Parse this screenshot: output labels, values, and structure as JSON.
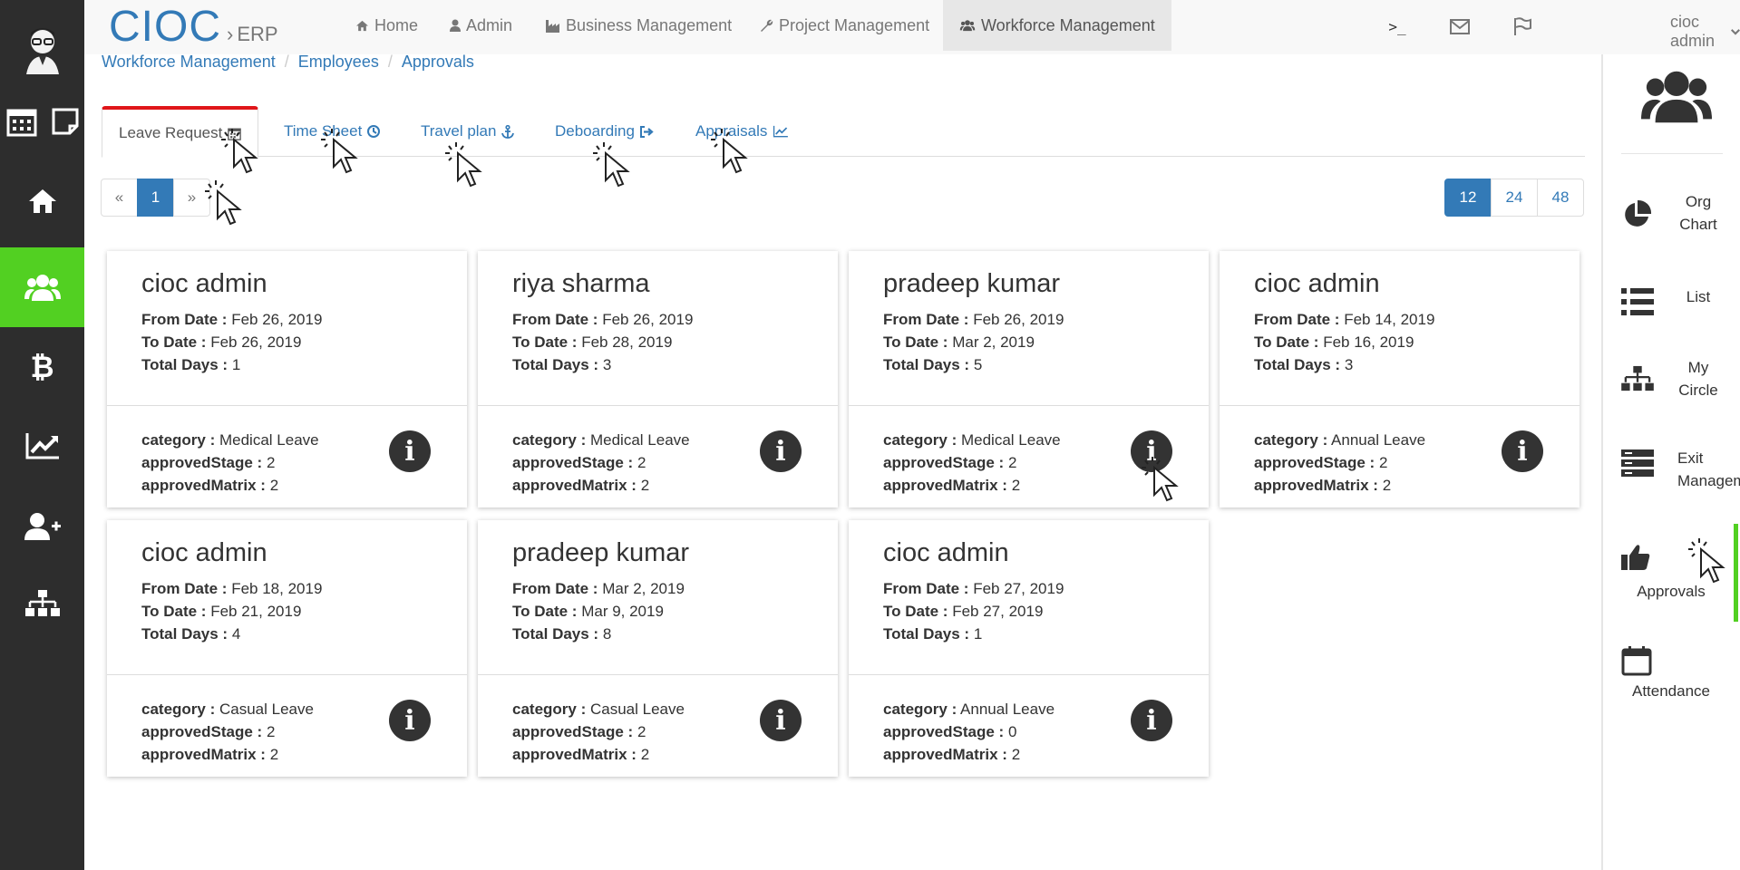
{
  "brand": {
    "main": "CIOC",
    "sep": "›",
    "sub": "ERP"
  },
  "nav": {
    "items": [
      {
        "label": "Home",
        "icon": "home-icon"
      },
      {
        "label": "Admin",
        "icon": "user-icon"
      },
      {
        "label": "Business Management",
        "icon": "industry-icon"
      },
      {
        "label": "Project Management",
        "icon": "wrench-icon"
      },
      {
        "label": "Workforce Management",
        "icon": "users-icon"
      }
    ],
    "terminal_label": ">_",
    "user": "cioc admin"
  },
  "breadcrumb": [
    "Workforce Management",
    "Employees",
    "Approvals"
  ],
  "breadcrumb_sep": "/",
  "tabs": [
    "Leave Request",
    "Time Sheet",
    "Travel plan",
    "Deboarding",
    "Appraisals"
  ],
  "pager": {
    "prev": "«",
    "current": "1",
    "next": "»"
  },
  "page_sizes": [
    "12",
    "24",
    "48"
  ],
  "field_labels": {
    "from": "From Date :",
    "to": "To Date :",
    "total": "Total Days :",
    "category": "category :",
    "stage": "approvedStage :",
    "matrix": "approvedMatrix :"
  },
  "cards": [
    {
      "name": "cioc admin",
      "from": "Feb 26, 2019",
      "to": "Feb 26, 2019",
      "total": "1",
      "category": "Medical Leave",
      "stage": "2",
      "matrix": "2"
    },
    {
      "name": "riya sharma",
      "from": "Feb 26, 2019",
      "to": "Feb 28, 2019",
      "total": "3",
      "category": "Medical Leave",
      "stage": "2",
      "matrix": "2"
    },
    {
      "name": "pradeep kumar",
      "from": "Feb 26, 2019",
      "to": "Mar 2, 2019",
      "total": "5",
      "category": "Medical Leave",
      "stage": "2",
      "matrix": "2"
    },
    {
      "name": "cioc admin",
      "from": "Feb 14, 2019",
      "to": "Feb 16, 2019",
      "total": "3",
      "category": "Annual Leave",
      "stage": "2",
      "matrix": "2"
    },
    {
      "name": "cioc admin",
      "from": "Feb 18, 2019",
      "to": "Feb 21, 2019",
      "total": "4",
      "category": "Casual Leave",
      "stage": "2",
      "matrix": "2"
    },
    {
      "name": "pradeep kumar",
      "from": "Mar 2, 2019",
      "to": "Mar 9, 2019",
      "total": "8",
      "category": "Casual Leave",
      "stage": "2",
      "matrix": "2"
    },
    {
      "name": "cioc admin",
      "from": "Feb 27, 2019",
      "to": "Feb 27, 2019",
      "total": "1",
      "category": "Annual Leave",
      "stage": "0",
      "matrix": "2"
    }
  ],
  "info_glyph": "i",
  "rightbar": {
    "items": [
      "Org Chart",
      "List",
      "My Circle",
      "Exit Management",
      "Approvals",
      "Attendance"
    ]
  },
  "leftbar": {
    "items": [
      "avatar",
      "calendar-icon",
      "home-icon",
      "users-icon",
      "bitcoin-icon",
      "line-chart-icon",
      "user-plus-icon",
      "sitemap-icon"
    ],
    "active": "users-icon"
  },
  "colors": {
    "accent": "#337ab7",
    "active_side": "#52d022",
    "tab_top": "#e0161a",
    "sidebar_bg": "#2d2d2d"
  }
}
